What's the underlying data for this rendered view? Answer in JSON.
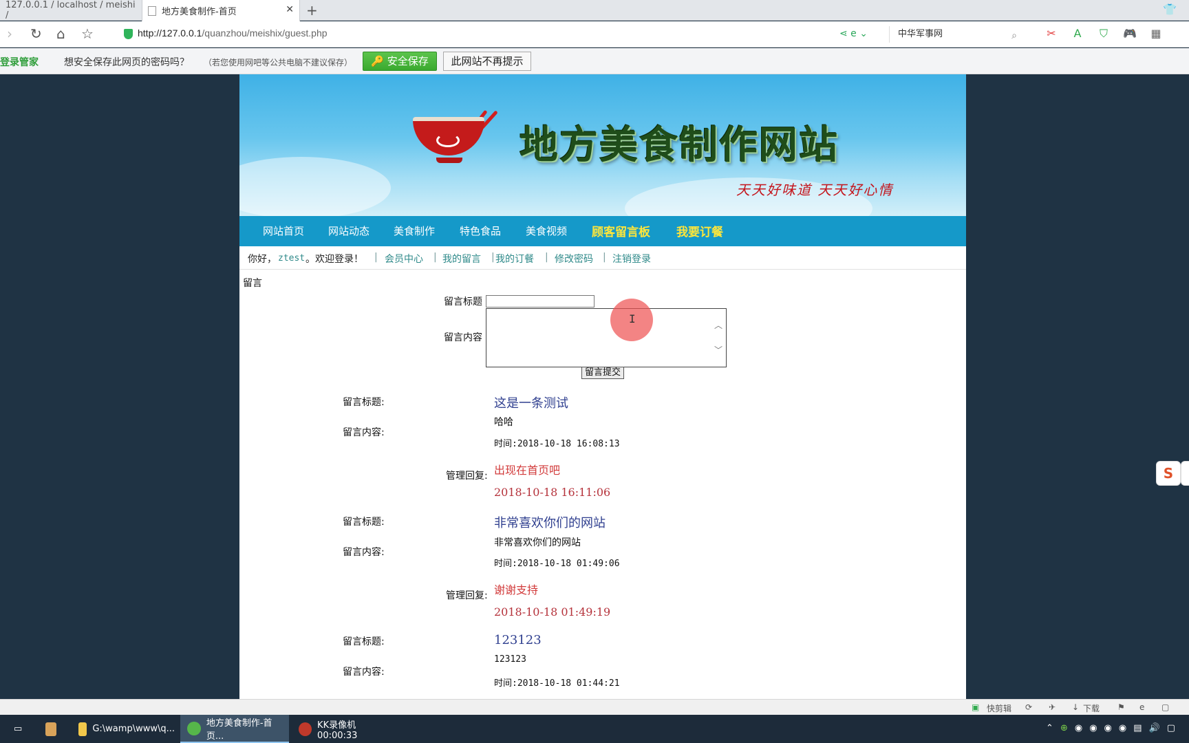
{
  "browser": {
    "tabs": [
      {
        "label": "127.0.0.1 / localhost / meishi /"
      },
      {
        "label": "地方美食制作-首页"
      }
    ],
    "url_host": "http://127.0.0.1",
    "url_path": "/quanzhou/meishix/guest.php",
    "search_text": "中华军事网"
  },
  "password_bar": {
    "brand": "登录管家",
    "question": "想安全保存此网页的密码吗？",
    "hint": "（若您使用网吧等公共电脑不建议保存）",
    "save_button": "安全保存",
    "never_button": "此网站不再提示"
  },
  "site": {
    "title": "地方美食制作网站",
    "slogan": "天天好味道 天天好心情",
    "nav": [
      "网站首页",
      "网站动态",
      "美食制作",
      "特色食品",
      "美食视频",
      "顾客留言板",
      "我要订餐"
    ],
    "greeting_prefix": "你好，",
    "username": "ztest",
    "greeting_suffix": "。欢迎登录！",
    "user_links": [
      "会员中心",
      "我的留言",
      "我的订餐",
      "修改密码",
      "注销登录"
    ]
  },
  "guestbook": {
    "section_label": "留言",
    "title_label": "留言标题",
    "content_label": "留言内容",
    "title_value": "",
    "content_value": "",
    "submit_label": "留言提交",
    "entry_title_label": "留言标题:",
    "entry_content_label": "留言内容:",
    "reply_label": "管理回复:",
    "entries": [
      {
        "title": "这是一条测试",
        "content": "哈哈",
        "time": "时间:2018-10-18 16:08:13",
        "reply": "出现在首页吧",
        "reply_time": "2018-10-18 16:11:06"
      },
      {
        "title": "非常喜欢你们的网站",
        "content": "非常喜欢你们的网站",
        "time": "时间:2018-10-18 01:49:06",
        "reply": "谢谢支持",
        "reply_time": "2018-10-18 01:49:19"
      },
      {
        "title": "123123",
        "content": "123123",
        "time": "时间:2018-10-18 01:44:21"
      }
    ]
  },
  "statusbar": {
    "clip": "快剪辑",
    "download": "下载"
  },
  "taskbar": {
    "items": [
      "G:\\wamp\\www\\q...",
      "地方美食制作-首页...",
      "KK录像机 00:00:33"
    ]
  }
}
